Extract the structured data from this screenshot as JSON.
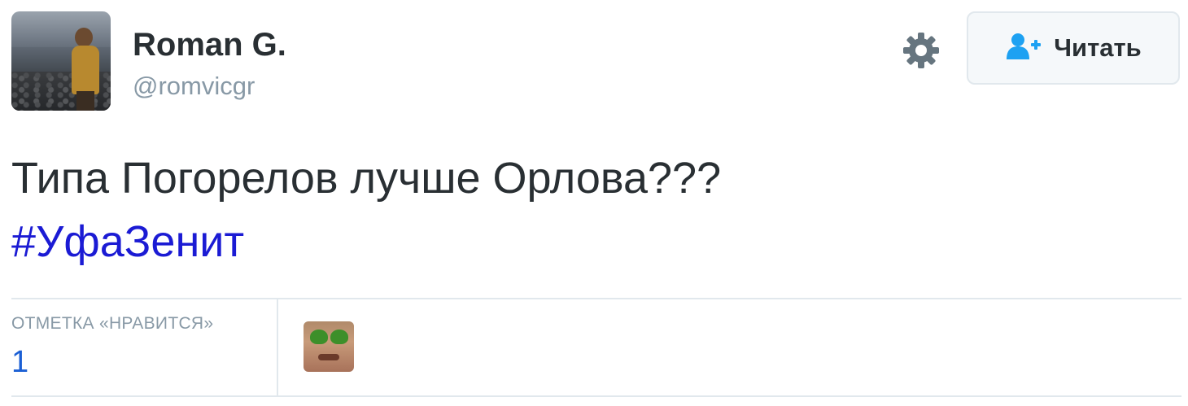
{
  "tweet": {
    "author": {
      "name": "Roman G.",
      "handle": "@romvicgr"
    },
    "follow_button": {
      "label": "Читать",
      "icon": "follow-user-plus-icon"
    },
    "settings_icon": "gear-icon",
    "text": "Типа Погорелов лучше Орлова???",
    "hashtag": "#УфаЗенит",
    "stats": {
      "likes_label": "ОТМЕТКА «НРАВИТСЯ»",
      "likes_count": "1"
    }
  },
  "colors": {
    "text": "#292f33",
    "muted": "#8899a6",
    "hashtag": "#1b1bd4",
    "link_count": "#1b5fd4",
    "follow_icon": "#1da1f2",
    "border": "#e1e8ed"
  }
}
